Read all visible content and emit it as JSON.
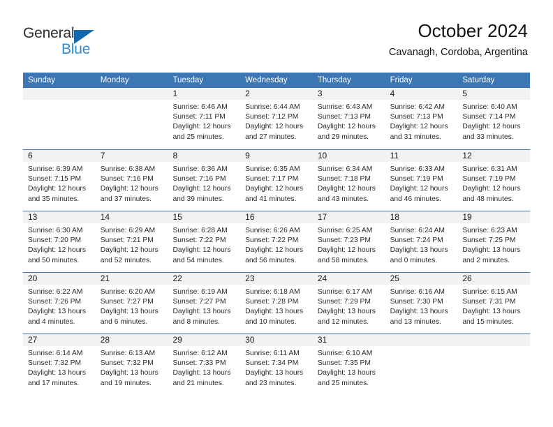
{
  "brand": {
    "name_part1": "General",
    "name_part2": "Blue",
    "accent_color": "#2f8ad4",
    "triangle_color": "#1368b0"
  },
  "header": {
    "title": "October 2024",
    "location": "Cavanagh, Cordoba, Argentina"
  },
  "calendar": {
    "header_color": "#3d76b4",
    "weekdays": [
      "Sunday",
      "Monday",
      "Tuesday",
      "Wednesday",
      "Thursday",
      "Friday",
      "Saturday"
    ],
    "weeks": [
      [
        {
          "day": "",
          "empty": true
        },
        {
          "day": "",
          "empty": true
        },
        {
          "day": "1",
          "sunrise": "Sunrise: 6:46 AM",
          "sunset": "Sunset: 7:11 PM",
          "daylight": "Daylight: 12 hours and 25 minutes."
        },
        {
          "day": "2",
          "sunrise": "Sunrise: 6:44 AM",
          "sunset": "Sunset: 7:12 PM",
          "daylight": "Daylight: 12 hours and 27 minutes."
        },
        {
          "day": "3",
          "sunrise": "Sunrise: 6:43 AM",
          "sunset": "Sunset: 7:13 PM",
          "daylight": "Daylight: 12 hours and 29 minutes."
        },
        {
          "day": "4",
          "sunrise": "Sunrise: 6:42 AM",
          "sunset": "Sunset: 7:13 PM",
          "daylight": "Daylight: 12 hours and 31 minutes."
        },
        {
          "day": "5",
          "sunrise": "Sunrise: 6:40 AM",
          "sunset": "Sunset: 7:14 PM",
          "daylight": "Daylight: 12 hours and 33 minutes."
        }
      ],
      [
        {
          "day": "6",
          "sunrise": "Sunrise: 6:39 AM",
          "sunset": "Sunset: 7:15 PM",
          "daylight": "Daylight: 12 hours and 35 minutes."
        },
        {
          "day": "7",
          "sunrise": "Sunrise: 6:38 AM",
          "sunset": "Sunset: 7:16 PM",
          "daylight": "Daylight: 12 hours and 37 minutes."
        },
        {
          "day": "8",
          "sunrise": "Sunrise: 6:36 AM",
          "sunset": "Sunset: 7:16 PM",
          "daylight": "Daylight: 12 hours and 39 minutes."
        },
        {
          "day": "9",
          "sunrise": "Sunrise: 6:35 AM",
          "sunset": "Sunset: 7:17 PM",
          "daylight": "Daylight: 12 hours and 41 minutes."
        },
        {
          "day": "10",
          "sunrise": "Sunrise: 6:34 AM",
          "sunset": "Sunset: 7:18 PM",
          "daylight": "Daylight: 12 hours and 43 minutes."
        },
        {
          "day": "11",
          "sunrise": "Sunrise: 6:33 AM",
          "sunset": "Sunset: 7:19 PM",
          "daylight": "Daylight: 12 hours and 46 minutes."
        },
        {
          "day": "12",
          "sunrise": "Sunrise: 6:31 AM",
          "sunset": "Sunset: 7:19 PM",
          "daylight": "Daylight: 12 hours and 48 minutes."
        }
      ],
      [
        {
          "day": "13",
          "sunrise": "Sunrise: 6:30 AM",
          "sunset": "Sunset: 7:20 PM",
          "daylight": "Daylight: 12 hours and 50 minutes."
        },
        {
          "day": "14",
          "sunrise": "Sunrise: 6:29 AM",
          "sunset": "Sunset: 7:21 PM",
          "daylight": "Daylight: 12 hours and 52 minutes."
        },
        {
          "day": "15",
          "sunrise": "Sunrise: 6:28 AM",
          "sunset": "Sunset: 7:22 PM",
          "daylight": "Daylight: 12 hours and 54 minutes."
        },
        {
          "day": "16",
          "sunrise": "Sunrise: 6:26 AM",
          "sunset": "Sunset: 7:22 PM",
          "daylight": "Daylight: 12 hours and 56 minutes."
        },
        {
          "day": "17",
          "sunrise": "Sunrise: 6:25 AM",
          "sunset": "Sunset: 7:23 PM",
          "daylight": "Daylight: 12 hours and 58 minutes."
        },
        {
          "day": "18",
          "sunrise": "Sunrise: 6:24 AM",
          "sunset": "Sunset: 7:24 PM",
          "daylight": "Daylight: 13 hours and 0 minutes."
        },
        {
          "day": "19",
          "sunrise": "Sunrise: 6:23 AM",
          "sunset": "Sunset: 7:25 PM",
          "daylight": "Daylight: 13 hours and 2 minutes."
        }
      ],
      [
        {
          "day": "20",
          "sunrise": "Sunrise: 6:22 AM",
          "sunset": "Sunset: 7:26 PM",
          "daylight": "Daylight: 13 hours and 4 minutes."
        },
        {
          "day": "21",
          "sunrise": "Sunrise: 6:20 AM",
          "sunset": "Sunset: 7:27 PM",
          "daylight": "Daylight: 13 hours and 6 minutes."
        },
        {
          "day": "22",
          "sunrise": "Sunrise: 6:19 AM",
          "sunset": "Sunset: 7:27 PM",
          "daylight": "Daylight: 13 hours and 8 minutes."
        },
        {
          "day": "23",
          "sunrise": "Sunrise: 6:18 AM",
          "sunset": "Sunset: 7:28 PM",
          "daylight": "Daylight: 13 hours and 10 minutes."
        },
        {
          "day": "24",
          "sunrise": "Sunrise: 6:17 AM",
          "sunset": "Sunset: 7:29 PM",
          "daylight": "Daylight: 13 hours and 12 minutes."
        },
        {
          "day": "25",
          "sunrise": "Sunrise: 6:16 AM",
          "sunset": "Sunset: 7:30 PM",
          "daylight": "Daylight: 13 hours and 13 minutes."
        },
        {
          "day": "26",
          "sunrise": "Sunrise: 6:15 AM",
          "sunset": "Sunset: 7:31 PM",
          "daylight": "Daylight: 13 hours and 15 minutes."
        }
      ],
      [
        {
          "day": "27",
          "sunrise": "Sunrise: 6:14 AM",
          "sunset": "Sunset: 7:32 PM",
          "daylight": "Daylight: 13 hours and 17 minutes."
        },
        {
          "day": "28",
          "sunrise": "Sunrise: 6:13 AM",
          "sunset": "Sunset: 7:32 PM",
          "daylight": "Daylight: 13 hours and 19 minutes."
        },
        {
          "day": "29",
          "sunrise": "Sunrise: 6:12 AM",
          "sunset": "Sunset: 7:33 PM",
          "daylight": "Daylight: 13 hours and 21 minutes."
        },
        {
          "day": "30",
          "sunrise": "Sunrise: 6:11 AM",
          "sunset": "Sunset: 7:34 PM",
          "daylight": "Daylight: 13 hours and 23 minutes."
        },
        {
          "day": "31",
          "sunrise": "Sunrise: 6:10 AM",
          "sunset": "Sunset: 7:35 PM",
          "daylight": "Daylight: 13 hours and 25 minutes."
        },
        {
          "day": "",
          "empty": true
        },
        {
          "day": "",
          "empty": true
        }
      ]
    ]
  }
}
